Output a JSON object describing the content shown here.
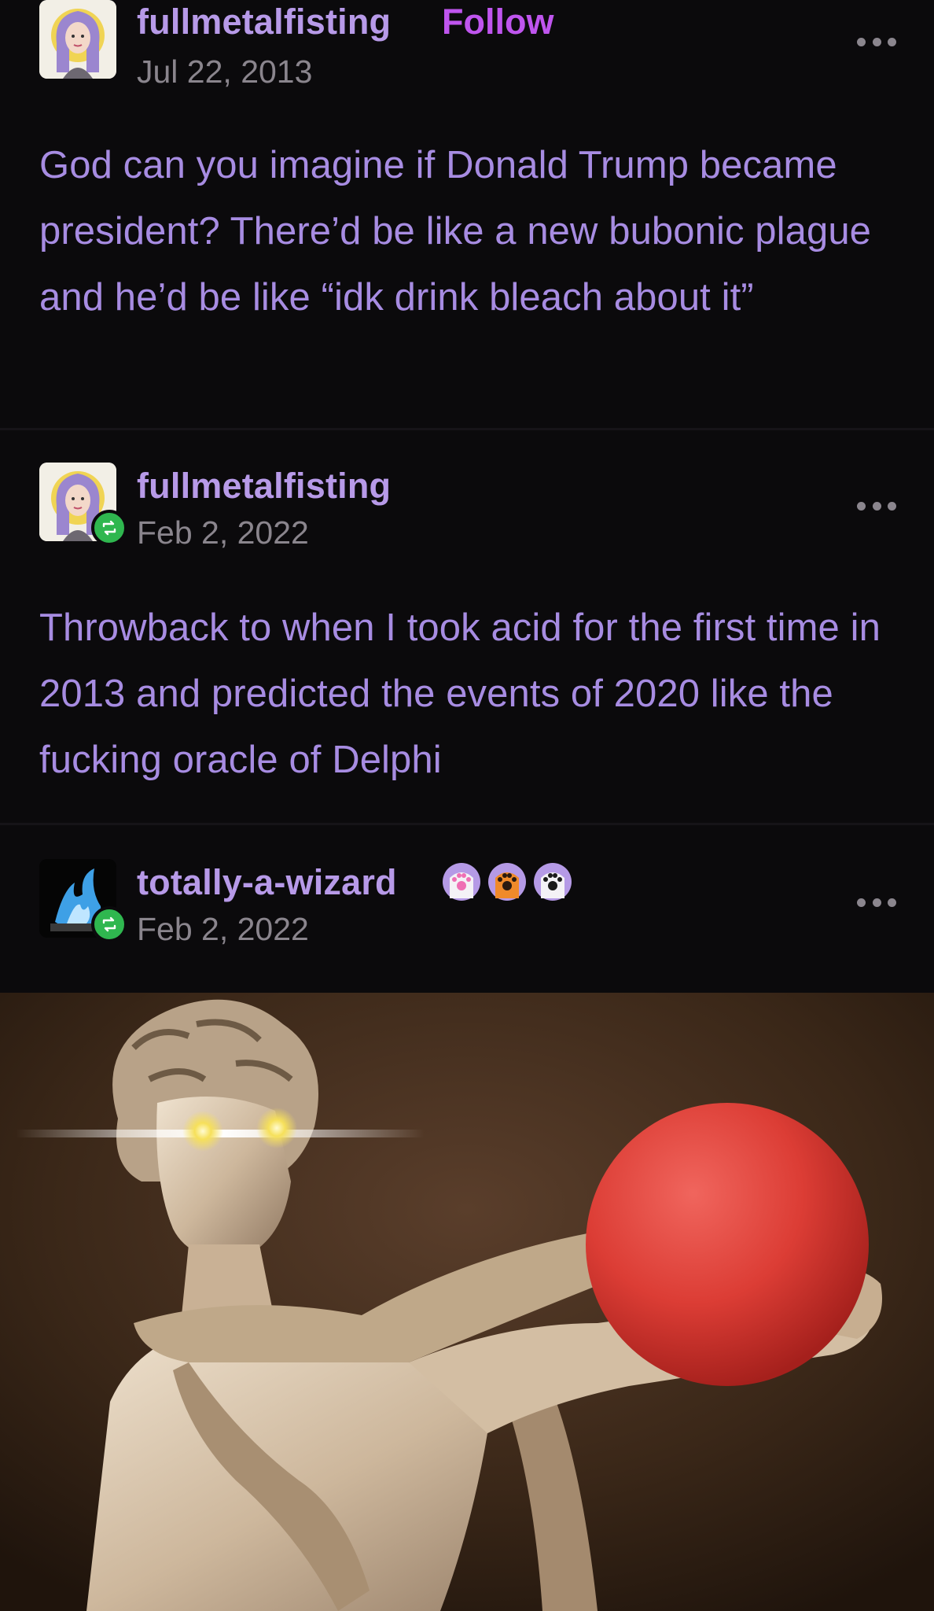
{
  "posts": [
    {
      "username": "fullmetalfisting",
      "follow_label": "Follow",
      "date": "Jul 22, 2013",
      "text": "God can you imagine if Donald Trump became president? There’d be like a new bubonic plague and he’d be like “idk drink bleach about it”",
      "avatar_icon": "user-avatar-illustration"
    },
    {
      "username": "fullmetalfisting",
      "date": "Feb 2, 2022",
      "text": "Throwback to when I took acid for the first time in 2013 and predicted the events of 2020 like the fucking oracle of Delphi",
      "avatar_icon": "user-avatar-illustration",
      "badge_icon": "reblog-icon"
    },
    {
      "username": "totally-a-wizard",
      "date": "Feb 2, 2022",
      "avatar_icon": "blue-fire-avatar",
      "badge_icon": "reblog-icon",
      "paw_badges": [
        "paw-badge-pink",
        "paw-badge-orange",
        "paw-badge-black"
      ]
    }
  ],
  "colors": {
    "background": "#0b0a0c",
    "username": "#b79ae8",
    "follow": "#bf55ee",
    "date": "#8a858d",
    "post_text": "#a78ce2",
    "reblog_badge": "#2fb74f",
    "ball": "#e0423c"
  }
}
